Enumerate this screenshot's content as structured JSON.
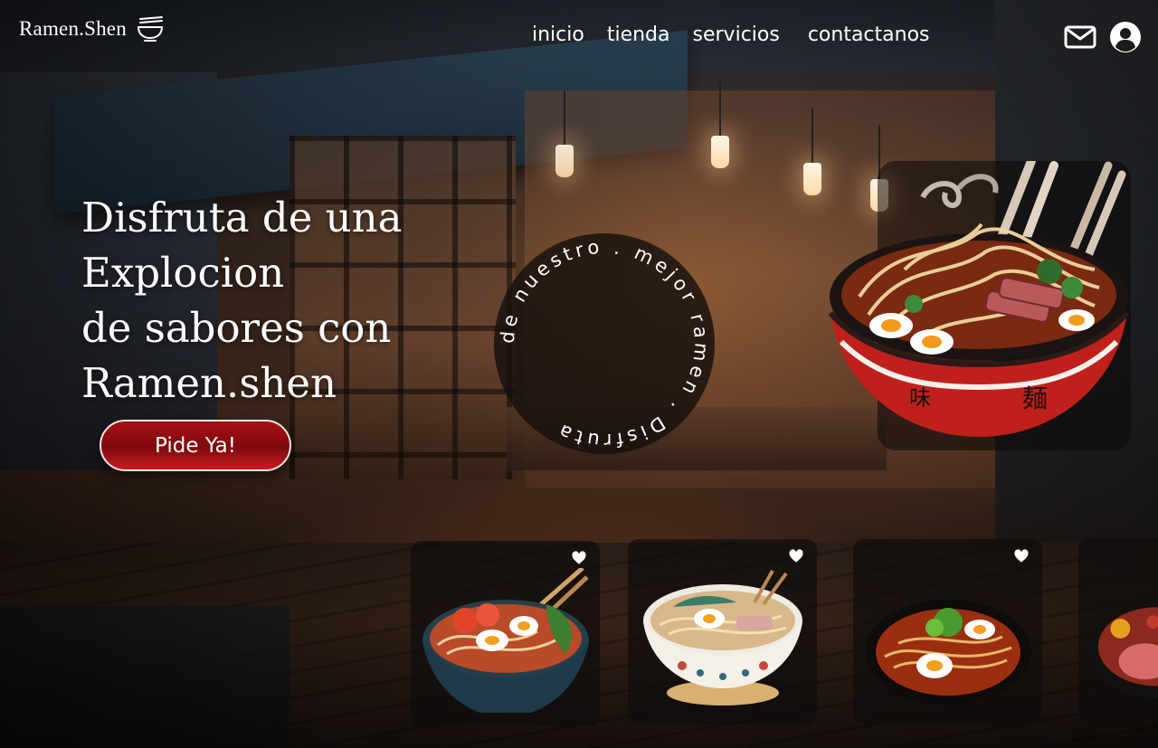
{
  "brand": {
    "name": "Ramen.Shen",
    "logo_icon": "ramen-bowl-icon"
  },
  "nav": {
    "items": [
      {
        "label": "inicio"
      },
      {
        "label": "tienda"
      },
      {
        "label": "servicios"
      },
      {
        "label": "contactanos"
      }
    ]
  },
  "header_icons": {
    "mail": "mail-icon",
    "user": "user-account-icon"
  },
  "hero": {
    "title_lines": [
      "Disfruta de una",
      "Explocion",
      "de sabores con",
      "Ramen.shen"
    ],
    "cta_label": "Pide Ya!",
    "circle_text": "de nuestro . mejor ramen . Disfruta "
  },
  "products": [
    {
      "icon": "ramen-bowl-tomato-egg-chopsticks",
      "favorite_icon": "heart-icon"
    },
    {
      "icon": "ramen-bowl-white-floral",
      "favorite_icon": "heart-icon"
    },
    {
      "icon": "ramen-bowl-spicy-egg",
      "favorite_icon": "heart-icon"
    },
    {
      "icon": "ramen-bowl-partial"
    }
  ],
  "colors": {
    "cta_red": "#a70f14",
    "text_white": "#ffffff",
    "card_bg": "#0f0c0c"
  }
}
